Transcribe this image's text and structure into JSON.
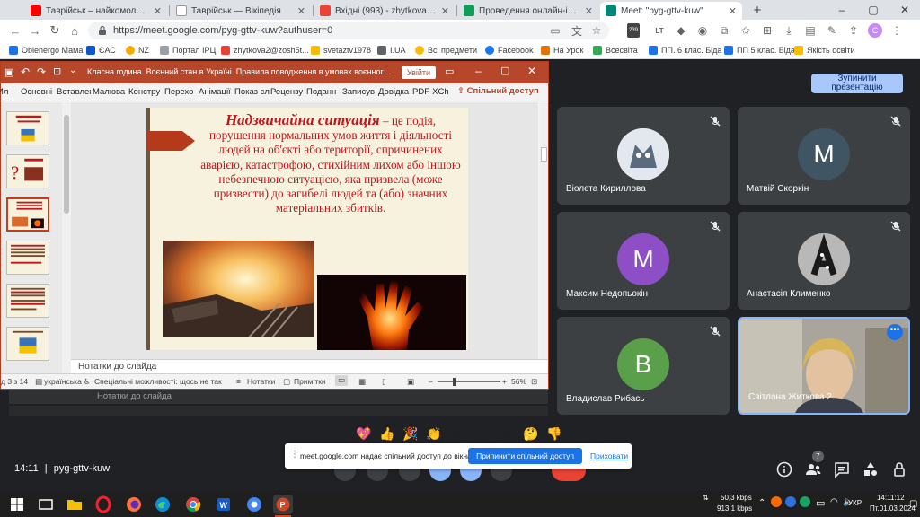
{
  "browser": {
    "tabs": [
      {
        "title": "Таврійськ – найкомолодше місто",
        "favicon_color": "#ff0000"
      },
      {
        "title": "Таврійськ — Вікіпедія",
        "favicon_color": "#ffffff"
      },
      {
        "title": "Вхідні (993) - zhytkova2@zosh5t",
        "favicon_color": "#ea4335"
      },
      {
        "title": "Проведення онлайн-інструктаж",
        "favicon_color": "#0f9d58"
      },
      {
        "title": "Meet: \"pyg-gttv-kuw\"",
        "favicon_color": "#00897b"
      }
    ],
    "new_tab": "+",
    "window_controls": {
      "minimize": "–",
      "maximize": "▢",
      "close": "✕"
    },
    "url": "https://meet.google.com/pyg-gttv-kuw?authuser=0",
    "badge": "239",
    "bookmarks": [
      {
        "label": "Oblenergo Мама",
        "color": "#1a73e8"
      },
      {
        "label": "ЄАС",
        "color": "#0b57d0"
      },
      {
        "label": "NZ",
        "color": "#f9ab00"
      },
      {
        "label": "Портал ІРЦ",
        "color": "#9aa0a6"
      },
      {
        "label": "zhytkova2@zosh5t...",
        "color": "#ea4335"
      },
      {
        "label": "svetaztv1978",
        "color": "#fbbc04"
      },
      {
        "label": "I.UA",
        "color": "#5f6368"
      },
      {
        "label": "Всі предмети",
        "color": "#fbbc04"
      },
      {
        "label": "Facebook",
        "color": "#1877f2"
      },
      {
        "label": "На Урок",
        "color": "#e37400"
      },
      {
        "label": "Всесвіта",
        "color": "#34a853"
      },
      {
        "label": "ПП. 6 клас. Біда",
        "color": "#1a73e8"
      },
      {
        "label": "ПП 5 клас. Біда",
        "color": "#1a73e8"
      },
      {
        "label": "Якість освіти",
        "color": "#fbbc04"
      }
    ]
  },
  "ppt": {
    "title": "Класна година. Воєнний стан в Україні. Правила поводження в умовах воєнного...",
    "signin": "Увійти",
    "ribbon_tabs": [
      "Ил",
      "Основні",
      "Вставлен",
      "Малюва",
      "Констру",
      "Перехо",
      "Анімації",
      "Показ сл",
      "Рецензу",
      "Поданн",
      "Записув",
      "Довідка",
      "PDF-XCh"
    ],
    "share": "Спільний доступ",
    "slide": {
      "heading": "Надзвичайна ситуація",
      "text": " – це подія, порушення нормальних умов життя і діяльності людей на об'єкті або території, спричинених аварією, катастрофою, стихійним лихом або іншою небезпечною ситуацією, яка призвела (може призвести) до загибелі людей та (або) значних матеріальних збитків."
    },
    "notes_placeholder": "Нотатки до слайда",
    "status": {
      "slide_num": "д 3 з 14",
      "language": "українська",
      "accessibility": "Спеціальні можливості: щось не так",
      "notes_btn": "Нотатки",
      "comments_btn": "Примітки",
      "zoom": "56%"
    }
  },
  "ghost": {
    "notes": "Нотатки до слайда"
  },
  "meet": {
    "stop_presenting": "Зупинити презентацію",
    "participants": [
      {
        "name": "Віолета Кириллова",
        "avatar_type": "image",
        "muted": true
      },
      {
        "name": "Матвій Скоркін",
        "initial": "M",
        "color": "#3f5564",
        "muted": true
      },
      {
        "name": "Максим Недопьокін",
        "initial": "M",
        "color": "#8e4ec6",
        "muted": true
      },
      {
        "name": "Анастасія Клименко",
        "avatar_type": "image",
        "muted": true
      },
      {
        "name": "Владислав Рибась",
        "initial": "B",
        "color": "#5aa04a",
        "muted": true
      },
      {
        "name": "Світлана Житкова 2",
        "avatar_type": "video",
        "muted": false
      }
    ],
    "reactions": [
      "💖",
      "👍",
      "🎉",
      "👏",
      "😂",
      "😮",
      "😢",
      "🤔",
      "👎"
    ],
    "share_message": "meet.google.com надає спільний доступ до вікна.",
    "stop_share": "Припинити спільний доступ",
    "hide": "Приховати",
    "time": "14:11",
    "meeting_code": "pyg-gttv-kuw",
    "participant_count": "7"
  },
  "taskbar": {
    "net_up": "50,3 kbps",
    "net_down": "913,1 kbps",
    "lang": "УКР",
    "time": "14:11:12",
    "date": "Пт.01.03.2024"
  },
  "colors": {
    "ppt_accent": "#b7472a",
    "meet_bg": "#202124",
    "tile_bg": "#3c4043",
    "slide_text": "#c0161c"
  }
}
